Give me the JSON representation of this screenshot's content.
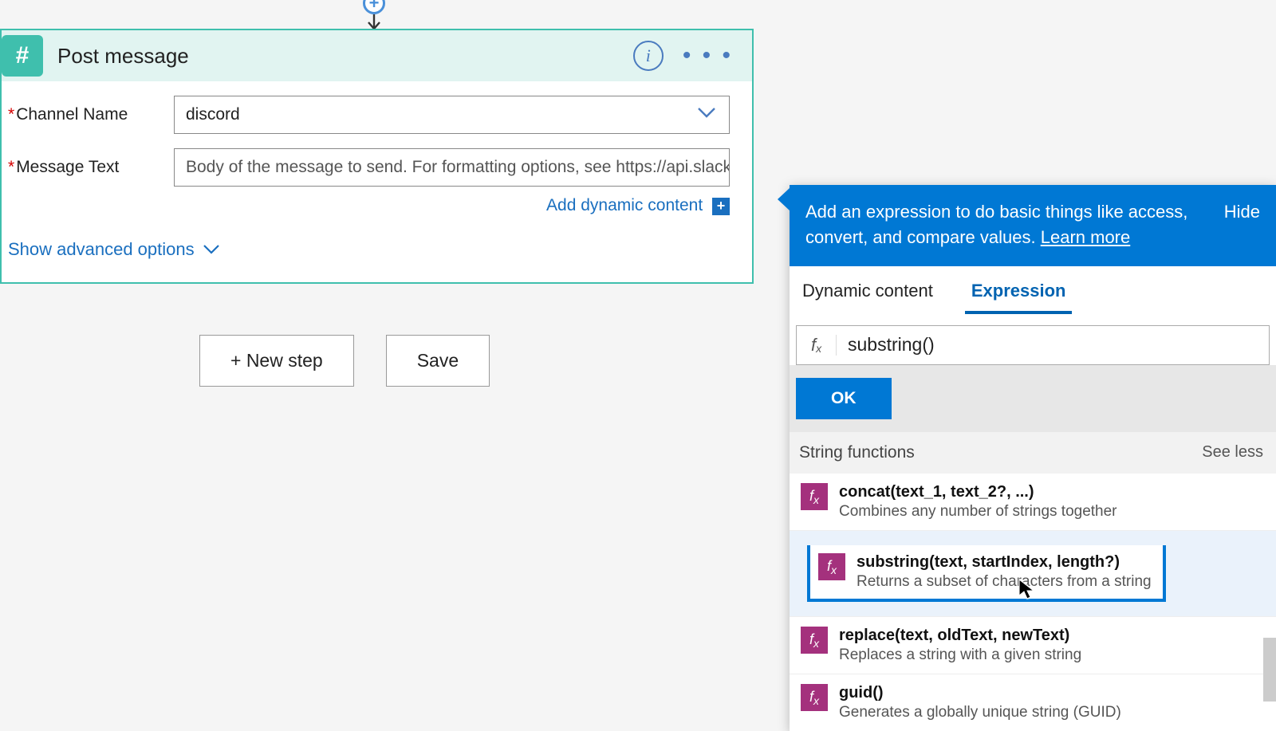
{
  "connector": {
    "plus_label": "+"
  },
  "card": {
    "icon_glyph": "#",
    "title": "Post message",
    "info_tooltip": "i",
    "menu_glyph": "• • •",
    "fields": {
      "channel": {
        "label": "Channel Name",
        "value": "discord",
        "required": true
      },
      "message": {
        "label": "Message Text",
        "required": true,
        "placeholder": "Body of the message to send. For formatting options, see https://api.slack.com."
      }
    },
    "add_dynamic_label": "Add dynamic content",
    "advanced_label": "Show advanced options"
  },
  "buttons": {
    "new_step": "+ New step",
    "save": "Save"
  },
  "panel": {
    "banner_text": "Add an expression to do basic things like access, convert, and compare values.",
    "learn_more": "Learn more",
    "hide": "Hide",
    "tabs": {
      "dynamic": "Dynamic content",
      "expression": "Expression",
      "active": "expression"
    },
    "fx_label": "fx",
    "expression_value": "substring()",
    "ok": "OK",
    "section_title": "String functions",
    "see_less": "See less",
    "functions": [
      {
        "sig": "concat(text_1, text_2?, ...)",
        "desc": "Combines any number of strings together",
        "selected": false
      },
      {
        "sig": "substring(text, startIndex, length?)",
        "desc": "Returns a subset of characters from a string",
        "selected": true
      },
      {
        "sig": "replace(text, oldText, newText)",
        "desc": "Replaces a string with a given string",
        "selected": false
      },
      {
        "sig": "guid()",
        "desc": "Generates a globally unique string (GUID)",
        "selected": false
      }
    ],
    "colors": {
      "primary": "#0078d4",
      "fn_icon": "#a4317d",
      "card_accent": "#3fbfad"
    }
  }
}
